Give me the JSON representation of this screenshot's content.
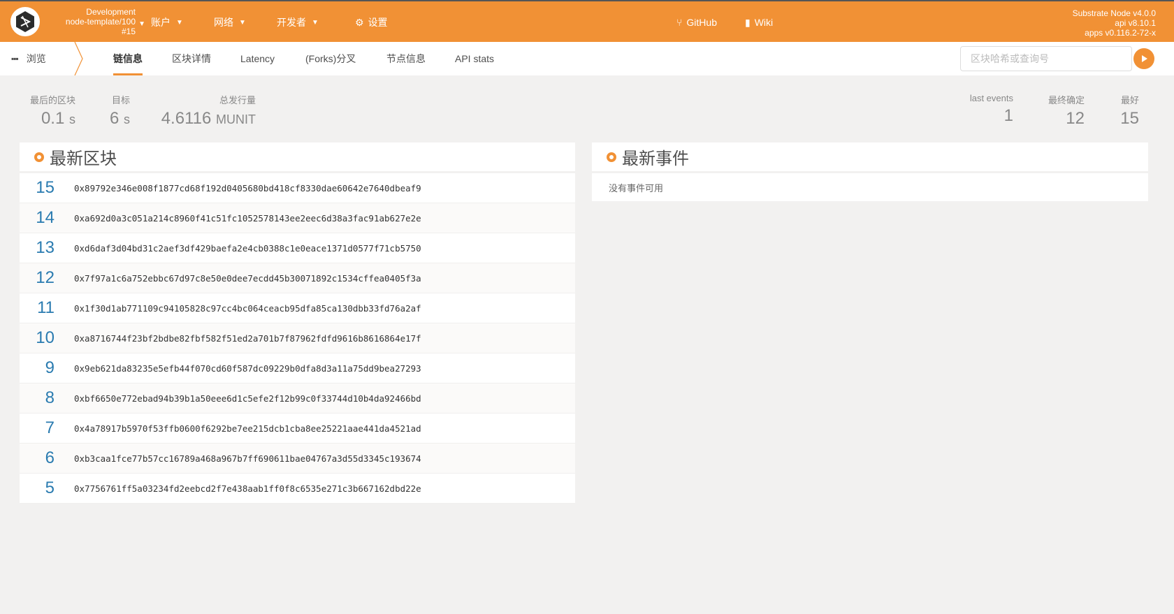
{
  "header": {
    "chain": {
      "name": "Development",
      "node": "node-template/100",
      "block": "#15"
    },
    "menus": [
      {
        "label": "账户"
      },
      {
        "label": "网络"
      },
      {
        "label": "开发者"
      },
      {
        "label": "设置"
      }
    ],
    "links": [
      {
        "label": "GitHub"
      },
      {
        "label": "Wiki"
      }
    ],
    "versions": {
      "node": "Substrate Node v4.0.0",
      "api": "api v8.10.1",
      "apps": "apps v0.116.2-72-x"
    }
  },
  "subnav": {
    "browse_label": "浏览",
    "tabs": [
      {
        "label": "链信息",
        "active": true
      },
      {
        "label": "区块详情"
      },
      {
        "label": "Latency"
      },
      {
        "label": "(Forks)分叉"
      },
      {
        "label": "节点信息"
      },
      {
        "label": "API stats"
      }
    ],
    "search_placeholder": "区块哈希或查询号"
  },
  "summary": {
    "last_block": {
      "label": "最后的区块",
      "value": "0.1",
      "unit": "s"
    },
    "target": {
      "label": "目标",
      "value": "6",
      "unit": "s"
    },
    "issuance": {
      "label": "总发行量",
      "value": "4.6116",
      "unit": "MUNIT"
    },
    "last_events": {
      "label": "last events",
      "value": "1"
    },
    "finalized": {
      "label": "最终确定",
      "value": "12"
    },
    "best": {
      "label": "最好",
      "value": "15"
    }
  },
  "blocks": {
    "title": "最新区块",
    "rows": [
      {
        "number": "15",
        "hash": "0x89792e346e008f1877cd68f192d0405680bd418cf8330dae60642e7640dbeaf9"
      },
      {
        "number": "14",
        "hash": "0xa692d0a3c051a214c8960f41c51fc1052578143ee2eec6d38a3fac91ab627e2e"
      },
      {
        "number": "13",
        "hash": "0xd6daf3d04bd31c2aef3df429baefa2e4cb0388c1e0eace1371d0577f71cb5750"
      },
      {
        "number": "12",
        "hash": "0x7f97a1c6a752ebbc67d97c8e50e0dee7ecdd45b30071892c1534cffea0405f3a"
      },
      {
        "number": "11",
        "hash": "0x1f30d1ab771109c94105828c97cc4bc064ceacb95dfa85ca130dbb33fd76a2af"
      },
      {
        "number": "10",
        "hash": "0xa8716744f23bf2bdbe82fbf582f51ed2a701b7f87962fdfd9616b8616864e17f"
      },
      {
        "number": "9",
        "hash": "0x9eb621da83235e5efb44f070cd60f587dc09229b0dfa8d3a11a75dd9bea27293"
      },
      {
        "number": "8",
        "hash": "0xbf6650e772ebad94b39b1a50eee6d1c5efe2f12b99c0f33744d10b4da92466bd"
      },
      {
        "number": "7",
        "hash": "0x4a78917b5970f53ffb0600f6292be7ee215dcb1cba8ee25221aae441da4521ad"
      },
      {
        "number": "6",
        "hash": "0xb3caa1fce77b57cc16789a468a967b7ff690611bae04767a3d55d3345c193674"
      },
      {
        "number": "5",
        "hash": "0x7756761ff5a03234fd2eebcd2f7e438aab1ff0f8c6535e271c3b667162dbd22e"
      }
    ]
  },
  "events": {
    "title": "最新事件",
    "empty": "没有事件可用"
  },
  "colors": {
    "accent": "#f19135",
    "link_blue": "#2a7bb0",
    "background": "#f2f1f0"
  }
}
